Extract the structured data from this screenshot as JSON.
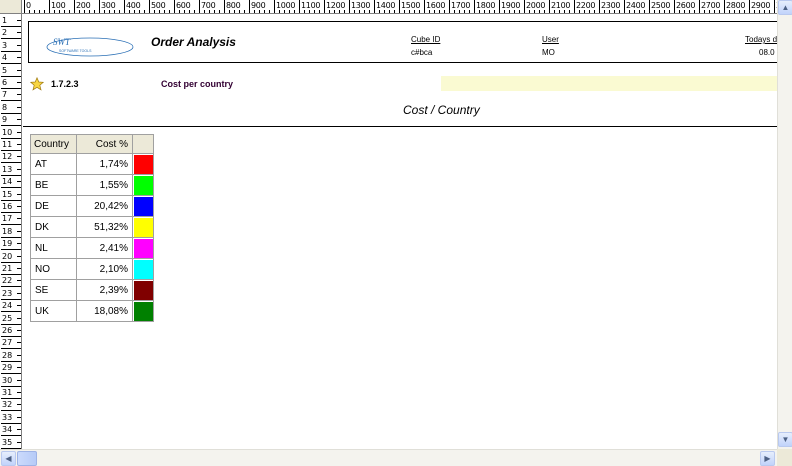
{
  "ruler_top": {
    "labels": [
      "0",
      "100",
      "200",
      "300",
      "400",
      "500",
      "600",
      "700",
      "800",
      "900",
      "1000",
      "1100",
      "1200",
      "1300",
      "1400",
      "1500",
      "1600",
      "1700",
      "1800",
      "1900",
      "2000",
      "2100",
      "2200",
      "2300",
      "2400",
      "2500",
      "2600",
      "2700",
      "2800",
      "2900",
      "3"
    ]
  },
  "ruler_left": {
    "labels": [
      "1",
      "2",
      "3",
      "4",
      "5",
      "6",
      "7",
      "8",
      "9",
      "10",
      "11",
      "12",
      "13",
      "14",
      "15",
      "16",
      "17",
      "18",
      "19",
      "20",
      "21",
      "22",
      "23",
      "24",
      "25",
      "26",
      "27",
      "28",
      "29",
      "30",
      "31",
      "32",
      "33",
      "34",
      "35"
    ]
  },
  "header": {
    "logo_text": "SWT",
    "logo_subtext": "SOFTWARE TOOLS",
    "title": "Order Analysis",
    "cube_id_label": "Cube ID",
    "cube_id_value": "c#bca",
    "user_label": "User",
    "user_value": "MO",
    "todays_label": "Todays d",
    "todays_value": "08.0"
  },
  "section": {
    "number": "1.7.2.3",
    "title": "Cost per country"
  },
  "chart_caption": "Cost / Country",
  "table": {
    "headers": {
      "country": "Country",
      "cost": "Cost %",
      "color": ""
    },
    "rows": [
      {
        "country": "AT",
        "cost": "1,74%",
        "color": "#ff0000"
      },
      {
        "country": "BE",
        "cost": "1,55%",
        "color": "#00ff00"
      },
      {
        "country": "DE",
        "cost": "20,42%",
        "color": "#0000ff"
      },
      {
        "country": "DK",
        "cost": "51,32%",
        "color": "#ffff00"
      },
      {
        "country": "NL",
        "cost": "2,41%",
        "color": "#ff00ff"
      },
      {
        "country": "NO",
        "cost": "2,10%",
        "color": "#00ffff"
      },
      {
        "country": "SE",
        "cost": "2,39%",
        "color": "#800000"
      },
      {
        "country": "UK",
        "cost": "18,08%",
        "color": "#008000"
      }
    ]
  },
  "colors": {
    "band": "#fafad2",
    "section_title": "#330033",
    "logo": "#2a6fb5"
  }
}
